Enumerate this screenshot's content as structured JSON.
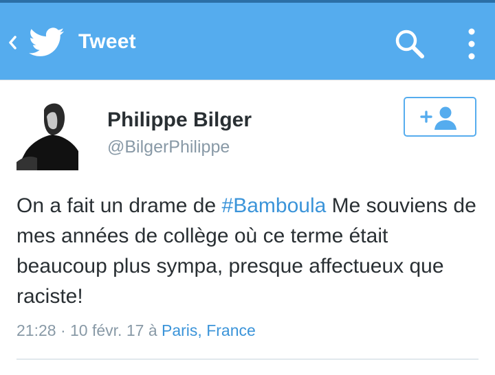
{
  "appbar": {
    "title": "Tweet",
    "background_color": "#55acee",
    "icons": [
      "back-chevron-icon",
      "twitter-bird-icon",
      "search-icon",
      "more-vertical-icon"
    ]
  },
  "author": {
    "display_name": "Philippe Bilger",
    "screen_name": "@BilgerPhilippe",
    "avatar_icon": "avatar",
    "follow_icon": "add-user-icon"
  },
  "tweet": {
    "text_before": "On a fait un drame de ",
    "hashtag": "#Bamboula",
    "text_after": " Me souviens de mes années de collège où ce terme était beaucoup plus sympa, presque affectueux que raciste!",
    "hashtag_color": "#3b94d9"
  },
  "meta": {
    "time": "21:28",
    "separator": " · ",
    "date": "10 févr. 17",
    "location_prefix": " à ",
    "location": "Paris, France"
  }
}
